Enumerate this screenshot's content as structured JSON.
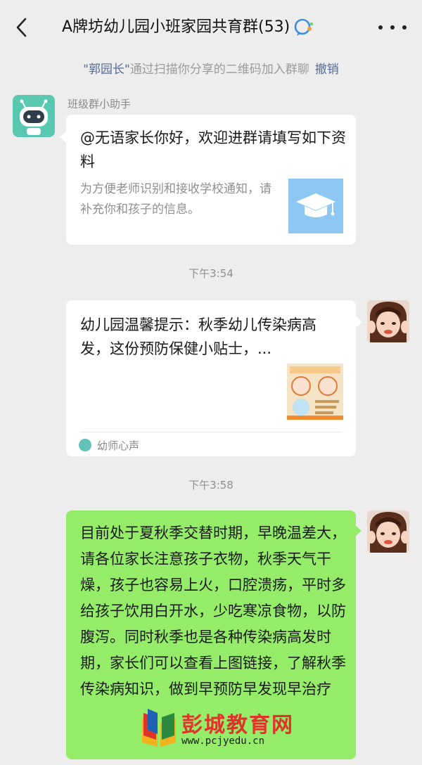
{
  "header": {
    "title": "A牌坊幼儿园小班家园共育群(53)",
    "back_icon": "chevron-left-icon",
    "title_icon": "group-chat-icon",
    "more_icon": "more-dots-icon"
  },
  "notice": {
    "who": "\"郭园长\"",
    "text": "通过扫描你分享的二维码加入群聊",
    "action": "撤销"
  },
  "messages": [
    {
      "sender": "班级群小助手",
      "title": "@无语家长你好，欢迎进群请填写如下资料",
      "desc": "为方便老师识别和接收学校通知，请补充你和孩子的信息。"
    },
    {
      "time": "下午3:54",
      "title": "幼儿园温馨提示：秋季幼儿传染病高发，这份预防保健小贴士，...",
      "source": "幼师心声"
    },
    {
      "time": "下午3:58",
      "text": "目前处于夏秋季交替时期，早晚温差大，请各位家长注意孩子衣物，秋季天气干燥，孩子也容易上火，口腔溃疡，平时多给孩子饮用白开水，少吃寒凉食物，以防腹泻。同时秋季也是各种传染病高发时期，家长们可以查看上图链接，了解秋季传染病知识，做到早预防早发现早治疗"
    }
  ],
  "watermark": {
    "title": "彭城教育网",
    "url": "www.pcjyedu.cn"
  },
  "colors": {
    "background": "#ededed",
    "self_bubble": "#95ec69",
    "link": "#576b95"
  }
}
